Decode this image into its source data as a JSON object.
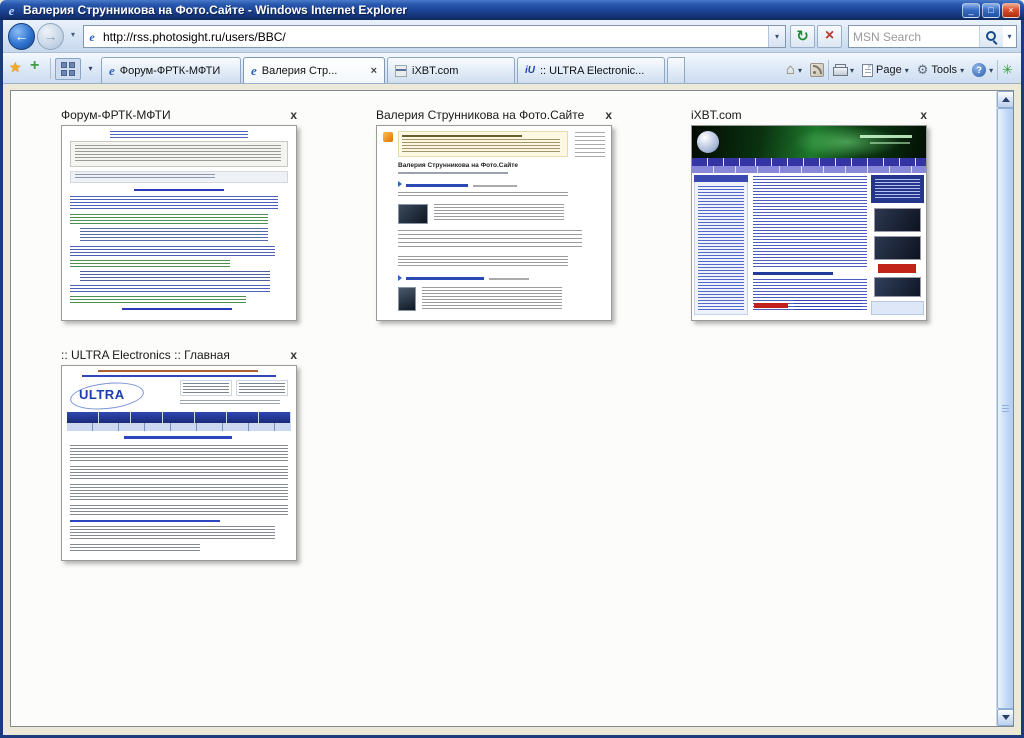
{
  "window": {
    "title": "Валерия Струнникова на Фото.Сайте - Windows Internet Explorer"
  },
  "navigation": {
    "url": "http://rss.photosight.ru/users/BBC/",
    "search_placeholder": "MSN Search"
  },
  "command_bar": {
    "page_label": "Page",
    "tools_label": "Tools"
  },
  "tabs": [
    {
      "label": "Форум-ФРТК-МФТИ"
    },
    {
      "label": "Валерия Стр...",
      "active": true
    },
    {
      "label": "iXBT.com"
    },
    {
      "label": ":: ULTRA Electronic..."
    }
  ],
  "quick_tabs": [
    {
      "title": "Форум-ФРТК-МФТИ"
    },
    {
      "title": "Валерия Струнникова на Фото.Сайте",
      "heading": "Валерия Струнникова на Фото.Сайте"
    },
    {
      "title": "iXBT.com"
    },
    {
      "title": ":: ULTRA Electronics :: Главная",
      "logo_text": "ULTRA"
    }
  ],
  "colors": {
    "titlebar_blue": "#1a3f8f",
    "toolbar_blue": "#d4e2f3",
    "accent_green": "#1f8c2f",
    "stop_red": "#c0392b"
  },
  "icons": {
    "ie_logo": "e",
    "back_arrow": "←",
    "forward_arrow": "→",
    "dropdown": "▾",
    "refresh": "↻",
    "stop": "×",
    "close": "x",
    "tab_close": "×",
    "favorites_star": "★",
    "add_favorite": "+",
    "home": "⌂",
    "gear": "⚙",
    "help": "?",
    "addon_flower": "✳",
    "minimize": "_",
    "maximize": "□",
    "window_close": "×",
    "ultra_favicon": "iU"
  }
}
